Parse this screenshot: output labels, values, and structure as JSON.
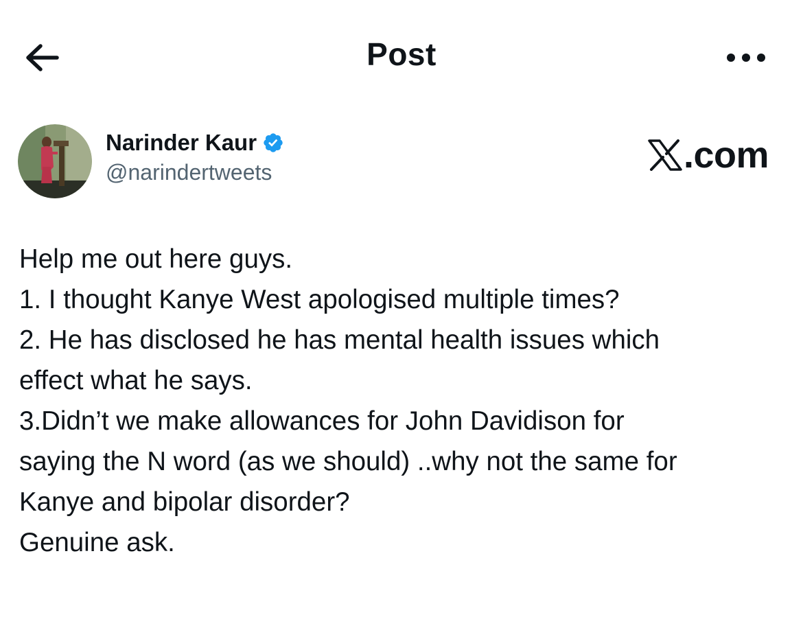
{
  "header": {
    "title": "Post",
    "back_icon": "arrow-left-icon",
    "more_icon": "ellipsis-icon"
  },
  "author": {
    "name": "Narinder Kaur",
    "handle": "@narindertweets",
    "verified": true,
    "verified_color": "#1d9bf0"
  },
  "watermark": {
    "text": ".com"
  },
  "tweet": {
    "lines": [
      "Help me out here guys.",
      "1. I thought Kanye West apologised multiple times?",
      "2. He has disclosed he has mental health issues which",
      "effect what he says.",
      "3.Didn’t we make allowances for John Davidison for",
      "saying the N word (as we should) ..why not the same for",
      "Kanye and bipolar disorder?",
      "Genuine ask."
    ]
  }
}
